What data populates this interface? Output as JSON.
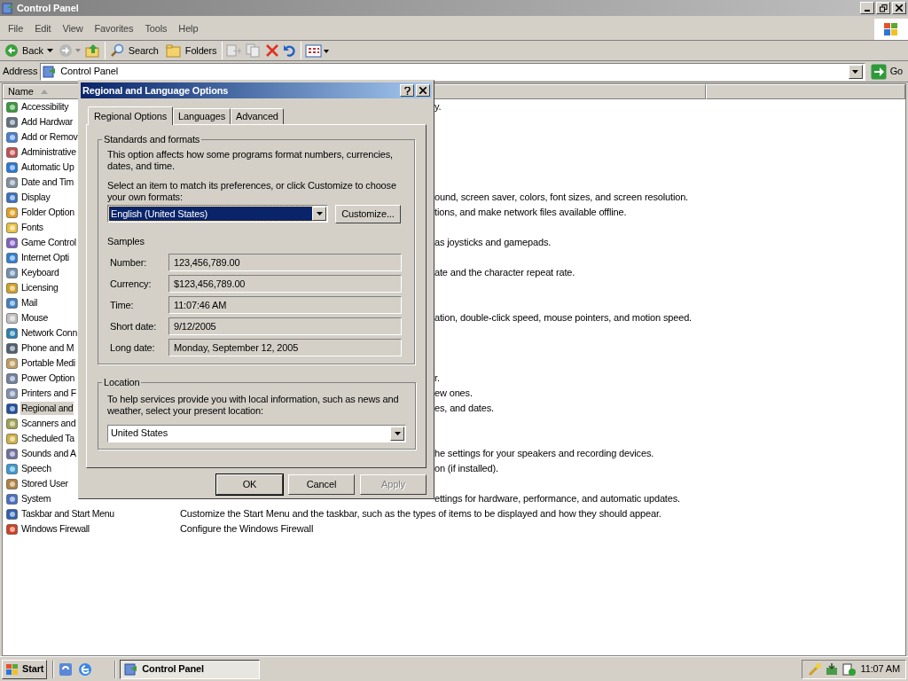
{
  "window": {
    "title": "Control Panel"
  },
  "menu": [
    {
      "label": "File"
    },
    {
      "label": "Edit"
    },
    {
      "label": "View"
    },
    {
      "label": "Favorites"
    },
    {
      "label": "Tools"
    },
    {
      "label": "Help"
    }
  ],
  "toolbar": {
    "back": "Back",
    "search": "Search",
    "folders": "Folders"
  },
  "address": {
    "label": "Address",
    "value": "Control Panel",
    "go": "Go"
  },
  "list": {
    "columns": [
      {
        "label": "Name",
        "sorted": true
      }
    ],
    "rows": [
      {
        "name": "Accessibility",
        "comment": "y.",
        "selected": false
      },
      {
        "name": "Add Hardwar",
        "selected": false
      },
      {
        "name": "Add or Remov",
        "selected": false
      },
      {
        "name": "Administrative",
        "selected": false
      },
      {
        "name": "Automatic Up",
        "selected": false
      },
      {
        "name": "Date and Tim",
        "selected": false
      },
      {
        "name": "Display",
        "comment": "ound, screen saver, colors, font sizes, and screen resolution.",
        "selected": false
      },
      {
        "name": "Folder Option",
        "comment": "tions, and make network files available offline.",
        "selected": false
      },
      {
        "name": "Fonts",
        "selected": false
      },
      {
        "name": "Game Control",
        "comment": "as joysticks and gamepads.",
        "selected": false
      },
      {
        "name": "Internet Opti",
        "selected": false
      },
      {
        "name": "Keyboard",
        "comment": "ate and the character repeat rate.",
        "selected": false
      },
      {
        "name": "Licensing",
        "selected": false
      },
      {
        "name": "Mail",
        "selected": false
      },
      {
        "name": "Mouse",
        "comment": "ation, double-click speed, mouse pointers, and motion speed.",
        "selected": false
      },
      {
        "name": "Network Conn",
        "selected": false
      },
      {
        "name": "Phone and M",
        "selected": false
      },
      {
        "name": "Portable Medi",
        "selected": false
      },
      {
        "name": "Power Option",
        "comment": "r.",
        "selected": false
      },
      {
        "name": "Printers and F",
        "comment": "ew ones.",
        "selected": false
      },
      {
        "name": "Regional and",
        "comment": "es, and dates.",
        "selected": true
      },
      {
        "name": "Scanners and",
        "selected": false
      },
      {
        "name": "Scheduled Ta",
        "selected": false
      },
      {
        "name": "Sounds and A",
        "comment": "he settings for your speakers and recording devices.",
        "selected": false
      },
      {
        "name": "Speech",
        "comment": "on (if installed).",
        "selected": false
      },
      {
        "name": "Stored User",
        "selected": false
      },
      {
        "name": "System",
        "comment": "ettings for hardware, performance, and automatic updates.",
        "selected": false
      },
      {
        "name": "Taskbar and Start Menu",
        "comment": "Customize the Start Menu and the taskbar, such as the types of items to be displayed and how they should appear.",
        "selected": false
      },
      {
        "name": "Windows Firewall",
        "comment": "Configure the Windows Firewall",
        "selected": false
      }
    ]
  },
  "dialog": {
    "title": "Regional and Language Options",
    "tabs": [
      {
        "label": "Regional Options",
        "selected": true
      },
      {
        "label": "Languages",
        "selected": false
      },
      {
        "label": "Advanced",
        "selected": false
      }
    ],
    "standards": {
      "legend": "Standards and formats",
      "description": "This option affects how some programs format numbers, currencies, dates, and time.",
      "prompt": "Select an item to match its preferences, or click Customize to choose your own formats:",
      "format": "English (United States)",
      "customize": "Customize...",
      "samples_label": "Samples",
      "samples": [
        {
          "label": "Number:",
          "value": "123,456,789.00"
        },
        {
          "label": "Currency:",
          "value": "$123,456,789.00"
        },
        {
          "label": "Time:",
          "value": "11:07:46 AM"
        },
        {
          "label": "Short date:",
          "value": "9/12/2005"
        },
        {
          "label": "Long date:",
          "value": "Monday, September 12, 2005"
        }
      ]
    },
    "location": {
      "legend": "Location",
      "description": "To help services provide you with local information, such as news and weather, select your present location:",
      "value": "United States"
    },
    "buttons": [
      {
        "label": "OK",
        "disabled": false
      },
      {
        "label": "Cancel",
        "disabled": false
      },
      {
        "label": "Apply",
        "disabled": true
      }
    ]
  },
  "taskbar": {
    "start": "Start",
    "tasks": [
      {
        "label": "Control Panel",
        "selected": true
      }
    ],
    "clock": "11:07 AM"
  }
}
